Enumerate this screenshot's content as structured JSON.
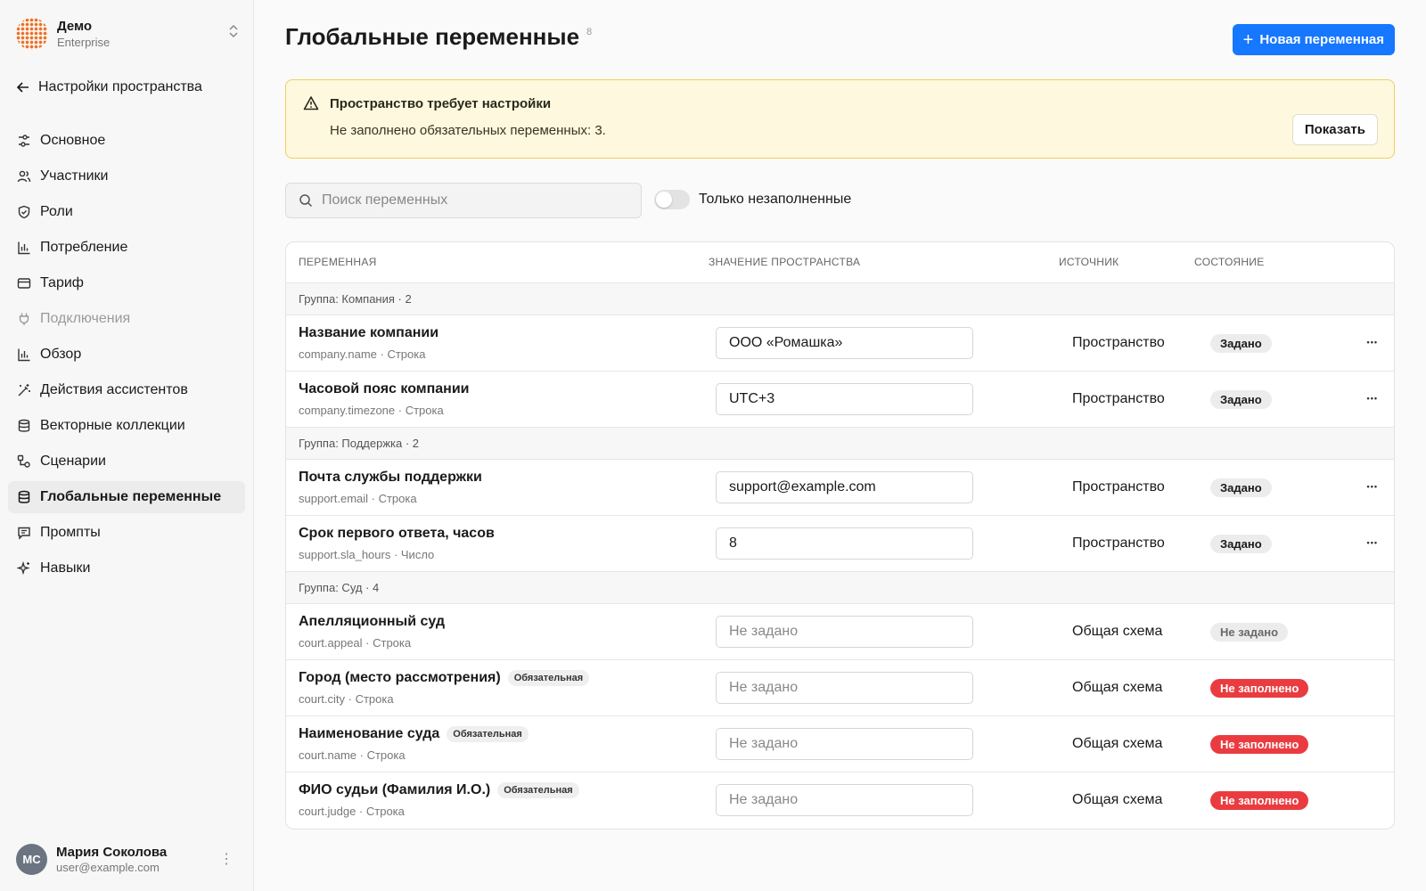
{
  "workspace": {
    "name": "Демо",
    "plan": "Enterprise"
  },
  "sidebar": {
    "back_label": "Настройки пространства",
    "items": [
      {
        "label": "Основное",
        "icon": "sliders-icon"
      },
      {
        "label": "Участники",
        "icon": "users-icon"
      },
      {
        "label": "Роли",
        "icon": "shield-icon"
      },
      {
        "label": "Потребление",
        "icon": "bar-chart-icon"
      },
      {
        "label": "Тариф",
        "icon": "credit-card-icon"
      },
      {
        "label": "Подключения",
        "icon": "plug-icon",
        "disabled": true
      },
      {
        "label": "Обзор",
        "icon": "bar-chart-icon"
      },
      {
        "label": "Действия ассистентов",
        "icon": "magic-wand-icon"
      },
      {
        "label": "Векторные коллекции",
        "icon": "database-icon"
      },
      {
        "label": "Сценарии",
        "icon": "workflow-icon"
      },
      {
        "label": "Глобальные переменные",
        "icon": "database-icon",
        "active": true
      },
      {
        "label": "Промпты",
        "icon": "message-icon"
      },
      {
        "label": "Навыки",
        "icon": "sparkles-icon"
      }
    ]
  },
  "user": {
    "initials": "МС",
    "name": "Мария Соколова",
    "email": "user@example.com"
  },
  "header": {
    "title": "Глобальные переменные",
    "count": "8",
    "new_button": "Новая переменная"
  },
  "alert": {
    "title": "Пространство требует настройки",
    "text": "Не заполнено обязательных переменных: 3.",
    "button": "Показать"
  },
  "filters": {
    "search_placeholder": "Поиск переменных",
    "toggle_label": "Только незаполненные"
  },
  "table": {
    "columns": [
      "ПЕРЕМЕННАЯ",
      "ЗНАЧЕНИЕ ПРОСТРАНСТВА",
      "ИСТОЧНИК",
      "СОСТОЯНИЕ"
    ],
    "groups": [
      {
        "label": "Группа: Компания · 2",
        "rows": [
          {
            "name": "Название компании",
            "key": "company.name · Строка",
            "value": "ООО «Ромашка»",
            "placeholder": "",
            "source": "Пространство",
            "status": "Задано",
            "status_type": "set",
            "required": ""
          },
          {
            "name": "Часовой пояс компании",
            "key": "company.timezone · Строка",
            "value": "UTC+3",
            "placeholder": "",
            "source": "Пространство",
            "status": "Задано",
            "status_type": "set",
            "required": ""
          }
        ]
      },
      {
        "label": "Группа: Поддержка · 2",
        "rows": [
          {
            "name": "Почта службы поддержки",
            "key": "support.email · Строка",
            "value": "support@example.com",
            "placeholder": "",
            "source": "Пространство",
            "status": "Задано",
            "status_type": "set",
            "required": ""
          },
          {
            "name": "Срок первого ответа, часов",
            "key": "support.sla_hours · Число",
            "value": "8",
            "placeholder": "",
            "source": "Пространство",
            "status": "Задано",
            "status_type": "set",
            "required": ""
          }
        ]
      },
      {
        "label": "Группа: Суд · 4",
        "rows": [
          {
            "name": "Апелляционный суд",
            "key": "court.appeal · Строка",
            "value": "",
            "placeholder": "Не задано",
            "source": "Общая схема",
            "status": "Не задано",
            "status_type": "unset",
            "required": ""
          },
          {
            "name": "Город (место рассмотрения)",
            "key": "court.city · Строка",
            "value": "",
            "placeholder": "Не задано",
            "source": "Общая схема",
            "status": "Не заполнено",
            "status_type": "missing",
            "required": "Обязательная"
          },
          {
            "name": "Наименование суда",
            "key": "court.name · Строка",
            "value": "",
            "placeholder": "Не задано",
            "source": "Общая схема",
            "status": "Не заполнено",
            "status_type": "missing",
            "required": "Обязательная"
          },
          {
            "name": "ФИО судьи (Фамилия И.О.)",
            "key": "court.judge · Строка",
            "value": "",
            "placeholder": "Не задано",
            "source": "Общая схема",
            "status": "Не заполнено",
            "status_type": "missing",
            "required": "Обязательная"
          }
        ]
      }
    ]
  },
  "colors": {
    "accent": "#1677ff",
    "alert_bg": "#fdf8de",
    "alert_border": "#f1d05a",
    "danger": "#ea3c40"
  }
}
